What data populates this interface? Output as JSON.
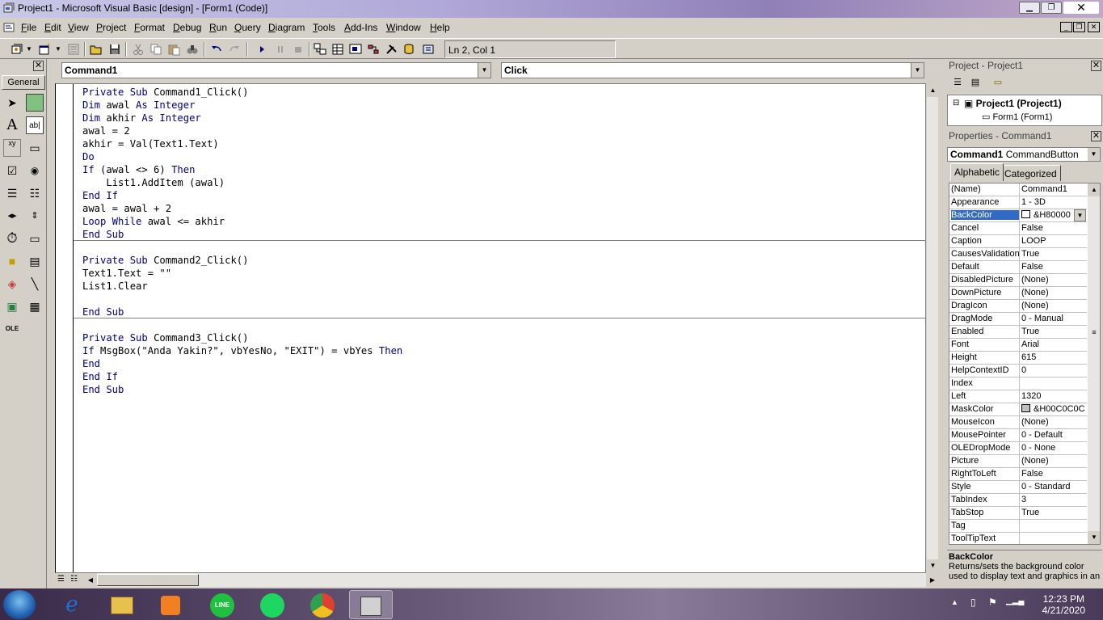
{
  "window": {
    "title": "Project1 - Microsoft Visual Basic [design] - [Form1 (Code)]"
  },
  "menu": [
    "File",
    "Edit",
    "View",
    "Project",
    "Format",
    "Debug",
    "Run",
    "Query",
    "Diagram",
    "Tools",
    "Add-Ins",
    "Window",
    "Help"
  ],
  "toolbar": {
    "cursor_position": "Ln 2, Col 1"
  },
  "toolbox": {
    "tab_label": "General"
  },
  "code_window": {
    "object_combo": "Command1",
    "procedure_combo": "Click",
    "procedures": [
      [
        [
          [
            "kw",
            "Private Sub "
          ],
          [
            "t",
            "Command1_Click()"
          ]
        ],
        [
          [
            "kw",
            "Dim "
          ],
          [
            "t",
            "awal "
          ],
          [
            "kw",
            "As Integer"
          ]
        ],
        [
          [
            "kw",
            "Dim "
          ],
          [
            "t",
            "akhir "
          ],
          [
            "kw",
            "As Integer"
          ]
        ],
        [
          [
            "t",
            "awal = 2"
          ]
        ],
        [
          [
            "t",
            "akhir = Val(Text1.Text)"
          ]
        ],
        [
          [
            "kw",
            "Do"
          ]
        ],
        [
          [
            "kw",
            "If "
          ],
          [
            "t",
            "(awal <> 6) "
          ],
          [
            "kw",
            "Then"
          ]
        ],
        [
          [
            "t",
            "    List1.AddItem (awal)"
          ]
        ],
        [
          [
            "kw",
            "End If"
          ]
        ],
        [
          [
            "t",
            "awal = awal + 2"
          ]
        ],
        [
          [
            "kw",
            "Loop While "
          ],
          [
            "t",
            "awal <= akhir"
          ]
        ],
        [
          [
            "kw",
            "End Sub"
          ]
        ]
      ],
      [
        [
          [
            "kw",
            "Private Sub "
          ],
          [
            "t",
            "Command2_Click()"
          ]
        ],
        [
          [
            "t",
            "Text1.Text = \"\""
          ]
        ],
        [
          [
            "t",
            "List1.Clear"
          ]
        ],
        [
          [
            "t",
            ""
          ]
        ],
        [
          [
            "kw",
            "End Sub"
          ]
        ]
      ],
      [
        [
          [
            "kw",
            "Private Sub "
          ],
          [
            "t",
            "Command3_Click()"
          ]
        ],
        [
          [
            "kw",
            "If "
          ],
          [
            "t",
            "MsgBox(\"Anda Yakin?\", vbYesNo, \"EXIT\") = vbYes "
          ],
          [
            "kw",
            "Then"
          ]
        ],
        [
          [
            "kw",
            "End"
          ]
        ],
        [
          [
            "kw",
            "End If"
          ]
        ],
        [
          [
            "kw",
            "End Sub"
          ]
        ]
      ]
    ]
  },
  "project_explorer": {
    "title": "Project - Project1",
    "root": "Project1 (Project1)",
    "child": "Form1 (Form1)"
  },
  "properties": {
    "title": "Properties - Command1",
    "object_name": "Command1",
    "object_type": "CommandButton",
    "tabs": [
      "Alphabetic",
      "Categorized"
    ],
    "selected": "BackColor",
    "rows": [
      [
        "(Name)",
        "Command1"
      ],
      [
        "Appearance",
        "1 - 3D"
      ],
      [
        "BackColor",
        "&H80000"
      ],
      [
        "Cancel",
        "False"
      ],
      [
        "Caption",
        "LOOP"
      ],
      [
        "CausesValidation",
        "True"
      ],
      [
        "Default",
        "False"
      ],
      [
        "DisabledPicture",
        "(None)"
      ],
      [
        "DownPicture",
        "(None)"
      ],
      [
        "DragIcon",
        "(None)"
      ],
      [
        "DragMode",
        "0 - Manual"
      ],
      [
        "Enabled",
        "True"
      ],
      [
        "Font",
        "Arial"
      ],
      [
        "Height",
        "615"
      ],
      [
        "HelpContextID",
        "0"
      ],
      [
        "Index",
        ""
      ],
      [
        "Left",
        "1320"
      ],
      [
        "MaskColor",
        "&H00C0C0C"
      ],
      [
        "MouseIcon",
        "(None)"
      ],
      [
        "MousePointer",
        "0 - Default"
      ],
      [
        "OLEDropMode",
        "0 - None"
      ],
      [
        "Picture",
        "(None)"
      ],
      [
        "RightToLeft",
        "False"
      ],
      [
        "Style",
        "0 - Standard"
      ],
      [
        "TabIndex",
        "3"
      ],
      [
        "TabStop",
        "True"
      ],
      [
        "Tag",
        ""
      ],
      [
        "ToolTipText",
        ""
      ]
    ],
    "description_title": "BackColor",
    "description_text": "Returns/sets the background color used to display text and graphics in an"
  },
  "taskbar": {
    "time": "12:23 PM",
    "date": "4/21/2020",
    "apps": [
      "internet-explorer-icon",
      "file-explorer-icon",
      "media-player-icon",
      "line-app-icon",
      "spotify-icon",
      "chrome-icon",
      "visual-basic-icon"
    ]
  },
  "colors": {
    "keyword": "#000080",
    "selection": "#316ac5"
  }
}
